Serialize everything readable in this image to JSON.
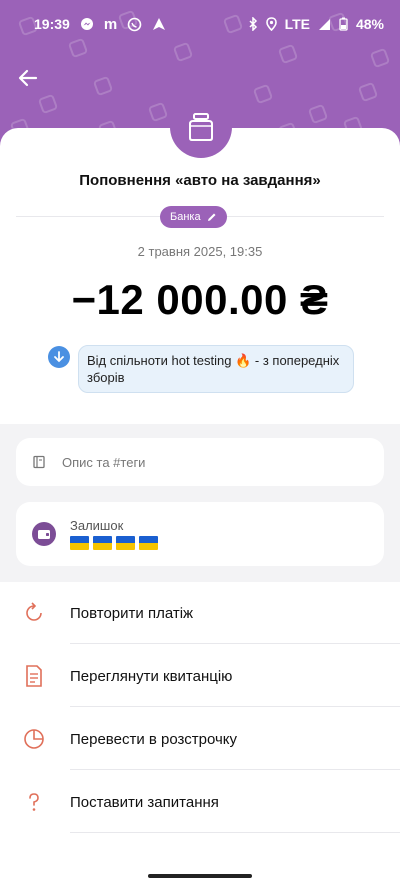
{
  "status_bar": {
    "time": "19:39",
    "network": "LTE",
    "battery": "48%"
  },
  "header": {
    "title": "Поповнення «авто на завдання»",
    "chip_label": "Банка",
    "date": "2 травня 2025, 19:35",
    "amount": "−12 000.00 ₴",
    "comment": "Від спільноти hot testing 🔥 - з попередніх зборів"
  },
  "details": {
    "description_placeholder": "Опис та #теги",
    "balance_label": "Залишок"
  },
  "actions": [
    {
      "label": "Повторити платіж",
      "icon": "repeat-icon"
    },
    {
      "label": "Переглянути квитанцію",
      "icon": "receipt-icon"
    },
    {
      "label": "Перевести в розстрочку",
      "icon": "pie-chart-icon"
    },
    {
      "label": "Поставити запитання",
      "icon": "question-icon"
    }
  ],
  "colors": {
    "brand": "#9b62b8",
    "accent_icon": "#e0705a",
    "comment_bg": "#e8f2fb"
  }
}
